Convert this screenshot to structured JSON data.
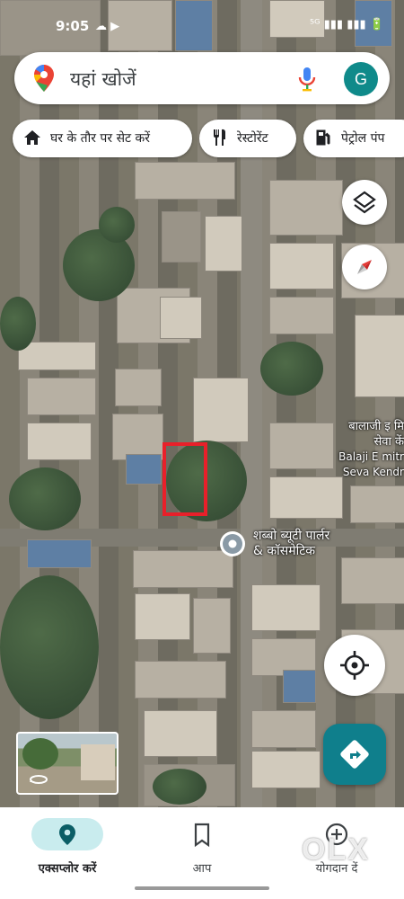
{
  "status_bar": {
    "time": "9:05",
    "right": "⁵ᴳ ▮▮▮ ▮▮▮ 🔋"
  },
  "search": {
    "placeholder": "यहां खोजें",
    "avatar_letter": "G"
  },
  "chips": [
    {
      "label": "घर के तौर पर सेट करें",
      "icon": "home-icon"
    },
    {
      "label": "रेस्टोरेंट",
      "icon": "restaurant-icon"
    },
    {
      "label": "पेट्रोल पंप",
      "icon": "gas-station-icon"
    }
  ],
  "map_labels": {
    "balaji_line1": "बालाजी इ मि",
    "balaji_line2": "सेवा कें",
    "balaji_line3": "Balaji E mitr",
    "balaji_line4": "Seva Kendr",
    "parlour_line1": "शब्बो ब्यूटी पार्लर",
    "parlour_line2": "& कॉसमेटिक"
  },
  "highlight_color": "#e8202a",
  "accent_color": "#0f7f8c",
  "bottom_nav": [
    {
      "label": "एक्सप्लोर करें",
      "icon": "explore-pin-icon",
      "active": true
    },
    {
      "label": "आप",
      "icon": "bookmark-icon",
      "active": false
    },
    {
      "label": "योगदान दें",
      "icon": "contribute-plus-icon",
      "active": false
    }
  ],
  "watermark": "OLX"
}
